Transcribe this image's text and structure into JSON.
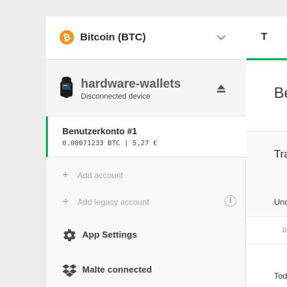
{
  "coin_select": {
    "label": "Bitcoin (BTC)",
    "logo_glyph": "₿",
    "logo_color": "#f7931a"
  },
  "device": {
    "name": "hardware-wallets",
    "status": "Disconnected device"
  },
  "account": {
    "name": "Benutzerkonto #1",
    "balance": "0.00071233 BTC | 5,27 €",
    "accent_color": "#01b757"
  },
  "actions": {
    "add_account": "Add account",
    "add_legacy_account": "Add legacy account",
    "info_glyph": "i"
  },
  "menu": {
    "app_settings": "App Settings",
    "dropbox": "Malte connected"
  },
  "main": {
    "tab_label": "T",
    "title": "Be",
    "section_title": "Tra",
    "sub_label": "Unc",
    "cell_text": "D",
    "footer_text": "Tod"
  }
}
